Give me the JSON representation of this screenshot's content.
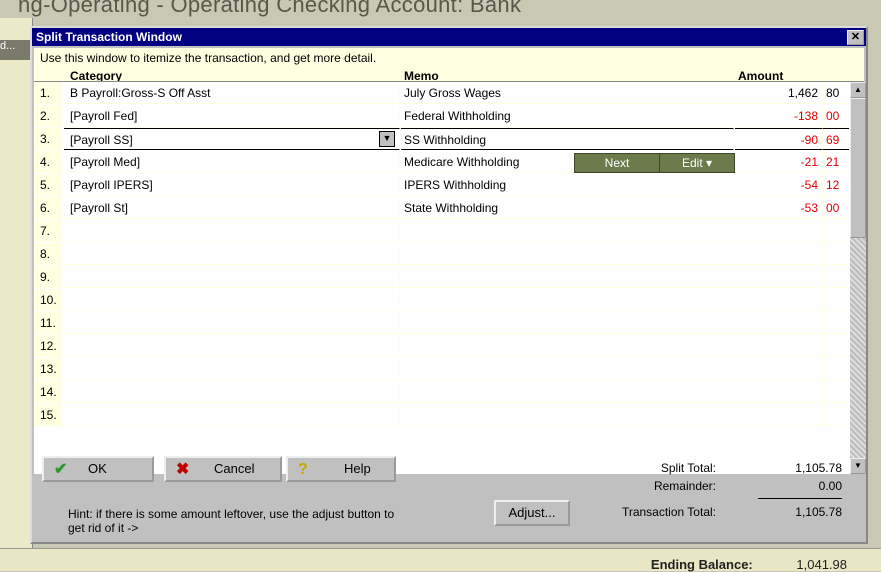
{
  "background": {
    "window_title": "ng-Operating - Operating Checking Account: Bank",
    "side_tab": "d...",
    "ending_balance_label": "Ending Balance:",
    "ending_balance_value": "1,041.98"
  },
  "dialog": {
    "title": "Split Transaction Window",
    "close_glyph": "✕",
    "instructions": "Use this window to itemize the transaction, and get more detail.",
    "columns": {
      "category": "Category",
      "memo": "Memo",
      "amount": "Amount"
    },
    "rows": [
      {
        "num": "1.",
        "category": "B Payroll:Gross-S Off Asst",
        "memo": "July Gross Wages",
        "amount": "1,462",
        "cents": "80",
        "negative": false
      },
      {
        "num": "2.",
        "category": "[Payroll Fed]",
        "memo": "Federal Withholding",
        "amount": "-138",
        "cents": "00",
        "negative": true
      },
      {
        "num": "3.",
        "category": "[Payroll SS]",
        "memo": "SS Withholding",
        "amount": "-90",
        "cents": "69",
        "negative": true
      },
      {
        "num": "4.",
        "category": "[Payroll Med]",
        "memo": "Medicare Withholding",
        "amount": "-21",
        "cents": "21",
        "negative": true
      },
      {
        "num": "5.",
        "category": "[Payroll IPERS]",
        "memo": "IPERS Withholding",
        "amount": "-54",
        "cents": "12",
        "negative": true
      },
      {
        "num": "6.",
        "category": "[Payroll St]",
        "memo": "State Withholding",
        "amount": "-53",
        "cents": "00",
        "negative": true
      },
      {
        "num": "7.",
        "category": "",
        "memo": "",
        "amount": "",
        "cents": "",
        "negative": false
      },
      {
        "num": "8.",
        "category": "",
        "memo": "",
        "amount": "",
        "cents": "",
        "negative": false
      },
      {
        "num": "9.",
        "category": "",
        "memo": "",
        "amount": "",
        "cents": "",
        "negative": false
      },
      {
        "num": "10.",
        "category": "",
        "memo": "",
        "amount": "",
        "cents": "",
        "negative": false
      },
      {
        "num": "11.",
        "category": "",
        "memo": "",
        "amount": "",
        "cents": "",
        "negative": false
      },
      {
        "num": "12.",
        "category": "",
        "memo": "",
        "amount": "",
        "cents": "",
        "negative": false
      },
      {
        "num": "13.",
        "category": "",
        "memo": "",
        "amount": "",
        "cents": "",
        "negative": false
      },
      {
        "num": "14.",
        "category": "",
        "memo": "",
        "amount": "",
        "cents": "",
        "negative": false
      },
      {
        "num": "15.",
        "category": "",
        "memo": "",
        "amount": "",
        "cents": "",
        "negative": false
      }
    ],
    "row_buttons": {
      "next": "Next",
      "edit": "Edit ▾"
    },
    "buttons": {
      "ok": "OK",
      "cancel": "Cancel",
      "help": "Help",
      "adjust": "Adjust..."
    },
    "hint": "Hint: if there is some amount leftover, use the adjust button to get rid of it ->",
    "totals": {
      "split_total_label": "Split Total:",
      "split_total_value": "1,105.78",
      "remainder_label": "Remainder:",
      "remainder_value": "0.00",
      "transaction_total_label": "Transaction Total:",
      "transaction_total_value": "1,105.78"
    }
  },
  "colors": {
    "title_bar": "#000080",
    "grid_header": "#ffffe1",
    "negative": "#e00000",
    "row_button": "#6b7b4b"
  }
}
